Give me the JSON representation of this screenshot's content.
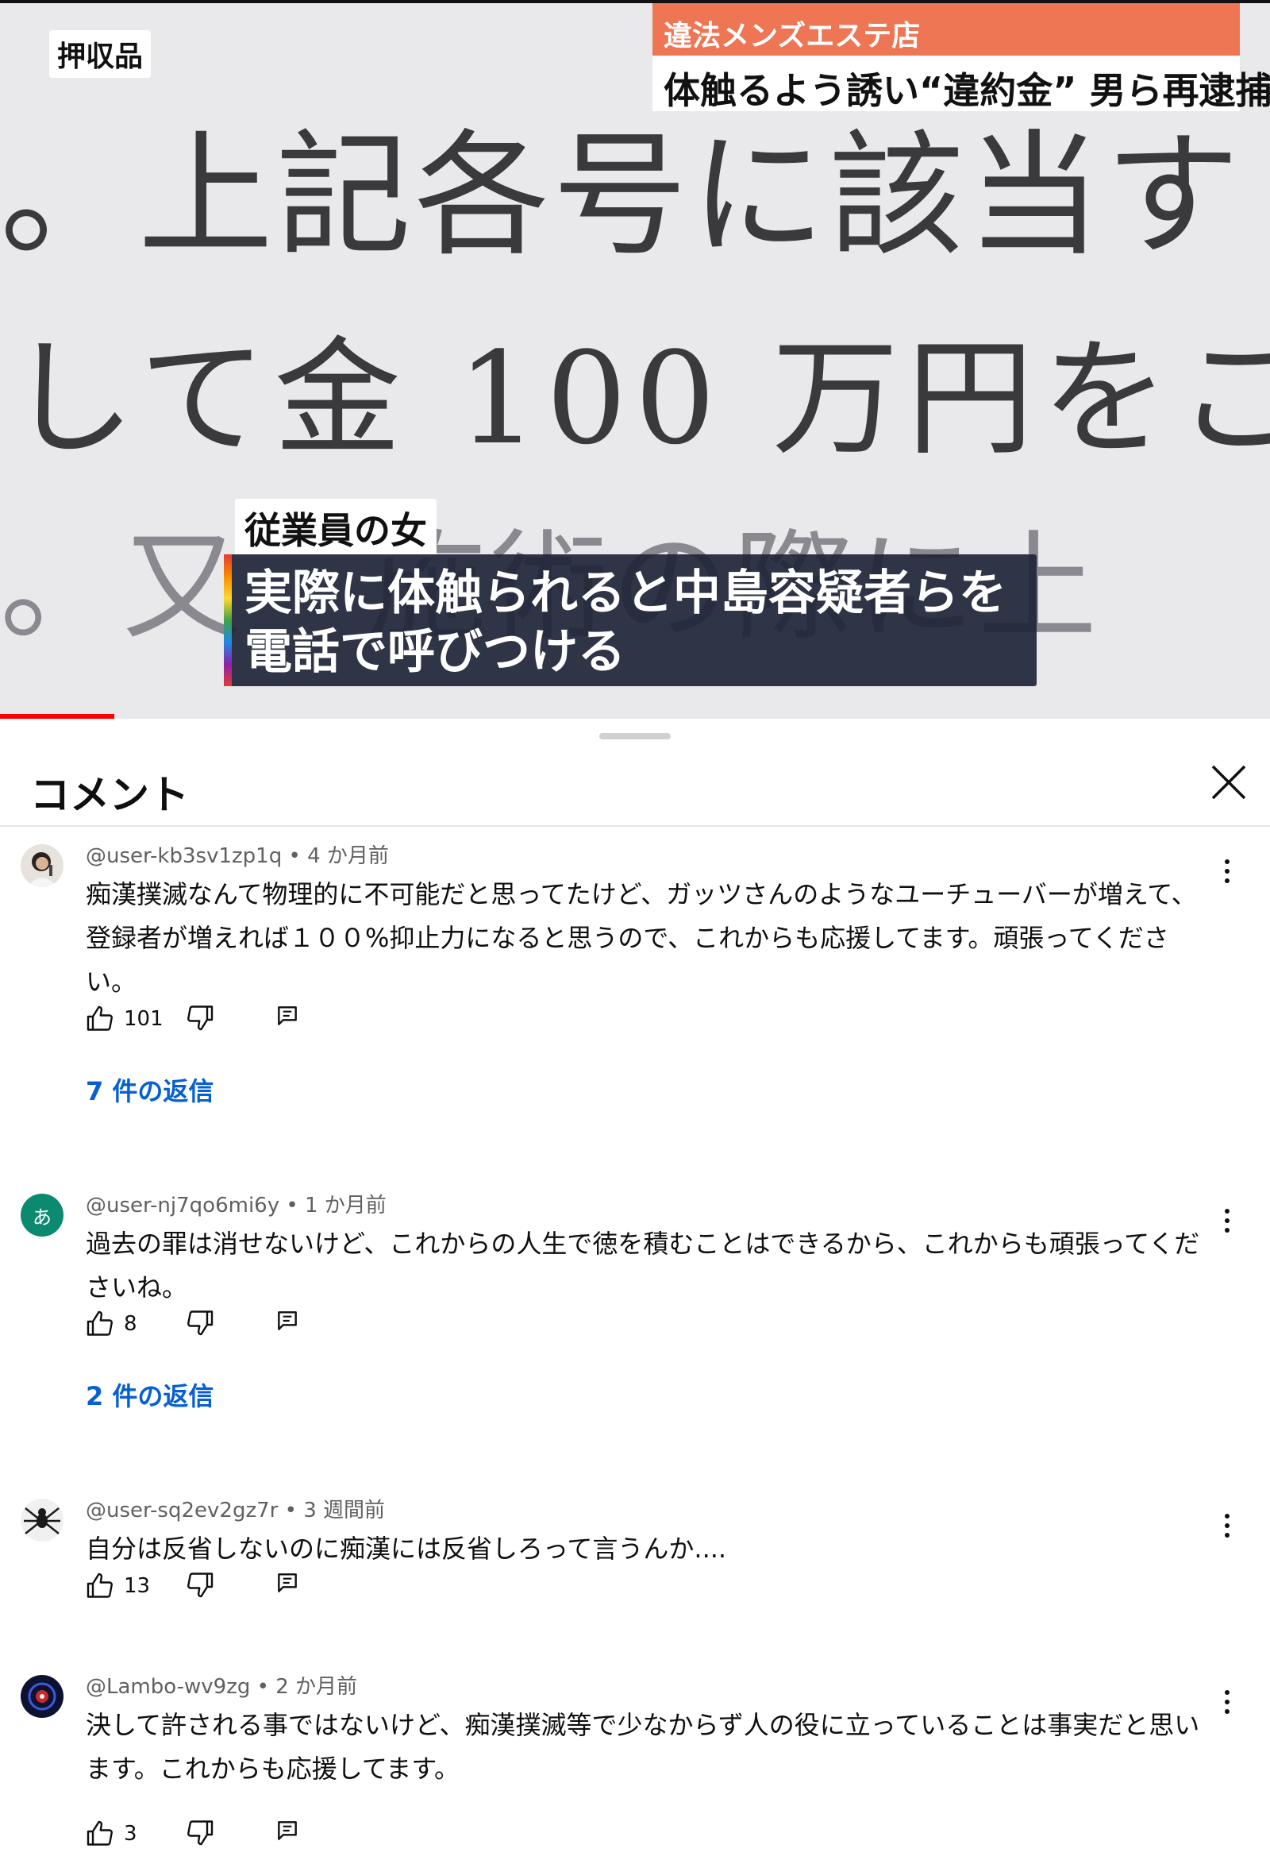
{
  "video": {
    "evidence_tag": "押収品",
    "headline_top": "違法メンズエステ店",
    "headline_main": "体触るよう誘い“違約金” 男ら再逮捕",
    "document_lines": [
      "。上記各号に該当す",
      "して金 100 万円をこ",
      "。又　施術の際に上",
      "　　　　　　　"
    ],
    "speaker_tag": "従業員の女",
    "caption_line1": "実際に体触られると中島容疑者らを",
    "caption_line2": "電話で呼びつける",
    "progress_fraction": 0.09
  },
  "comments_panel": {
    "title": "コメント",
    "close_icon": "close-icon",
    "accent_color": "#065fd4",
    "comments": [
      {
        "author": "@user-kb3sv1zp1q",
        "time": "4 か月前",
        "text": "痴漢撲滅なんて物理的に不可能だと思ってたけど、ガッツさんのようなユーチューバーが増えて、登録者が増えれば１００%抑止力になると思うので、これからも応援してます。頑張ってください。",
        "likes": "101",
        "replies": "7 件の返信",
        "avatar_icon": "photo-avatar"
      },
      {
        "author": "@user-nj7qo6mi6y",
        "time": "1 か月前",
        "text": "過去の罪は消せないけど、これからの人生で徳を積むことはできるから、これからも頑張ってくださいね。",
        "likes": "8",
        "replies": "2 件の返信",
        "avatar_letter": "あ",
        "avatar_color": "#0b8a6f"
      },
      {
        "author": "@user-sq2ev2gz7r",
        "time": "3 週間前",
        "text": "自分は反省しないのに痴漢には反省しろって言うんか....",
        "likes": "13",
        "avatar_icon": "spider-avatar"
      },
      {
        "author": "@Lambo-wv9zg",
        "time": "2 か月前",
        "text": "決して許される事ではないけど、痴漢撲滅等で少なからず人の役に立っていることは事実だと思います。これからも応援してます。",
        "likes": "3",
        "avatar_icon": "dark-emblem-avatar"
      }
    ],
    "icons": [
      "like-icon",
      "dislike-icon",
      "reply-icon",
      "more-vert-icon"
    ]
  }
}
